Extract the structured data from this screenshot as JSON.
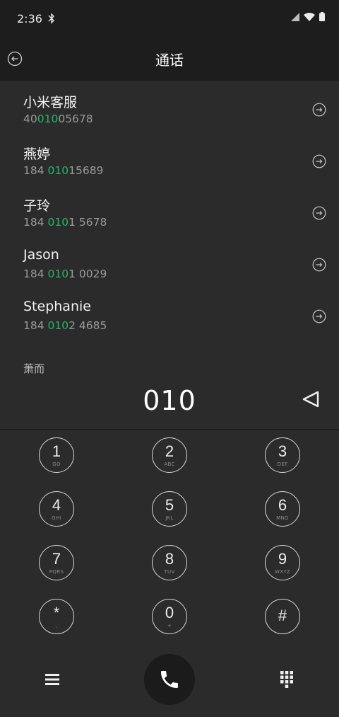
{
  "status": {
    "time": "2:36"
  },
  "header": {
    "title": "通话"
  },
  "contacts": [
    {
      "name": "小米客服",
      "num_pre": "40",
      "num_hl": "010",
      "num_post": "05678"
    },
    {
      "name": "燕婷",
      "num_pre": "184 ",
      "num_hl": "010",
      "num_post": "15689"
    },
    {
      "name": "子玲",
      "num_pre": "184 ",
      "num_hl": "010",
      "num_post": "1 5678"
    },
    {
      "name": "Jason",
      "num_pre": "184 ",
      "num_hl": "010",
      "num_post": "1 0029"
    },
    {
      "name": "Stephanie",
      "num_pre": "184 ",
      "num_hl": "010",
      "num_post": "2 4685"
    }
  ],
  "partial_contact": "萧而",
  "dial": {
    "value": "010"
  },
  "keypad": [
    {
      "digit": "1",
      "letters": "GO"
    },
    {
      "digit": "2",
      "letters": "ABC"
    },
    {
      "digit": "3",
      "letters": "DEF"
    },
    {
      "digit": "4",
      "letters": "GHI"
    },
    {
      "digit": "5",
      "letters": "JKL"
    },
    {
      "digit": "6",
      "letters": "MNO"
    },
    {
      "digit": "7",
      "letters": "PQRS"
    },
    {
      "digit": "8",
      "letters": "TUV"
    },
    {
      "digit": "9",
      "letters": "WXYZ"
    },
    {
      "digit": "*",
      "letters": ","
    },
    {
      "digit": "0",
      "letters": "+"
    },
    {
      "digit": "#",
      "letters": ""
    }
  ],
  "icons": {
    "back": "back-arrow-icon",
    "contact_action": "circle-arrow-right-icon",
    "backspace": "backspace-triangle-icon",
    "menu": "hamburger-menu-icon",
    "call": "phone-icon",
    "keypad_toggle": "dialpad-grid-icon"
  },
  "colors": {
    "highlight": "#28b36b",
    "background": "#2b2b2b",
    "bar": "#1d1d1d"
  }
}
